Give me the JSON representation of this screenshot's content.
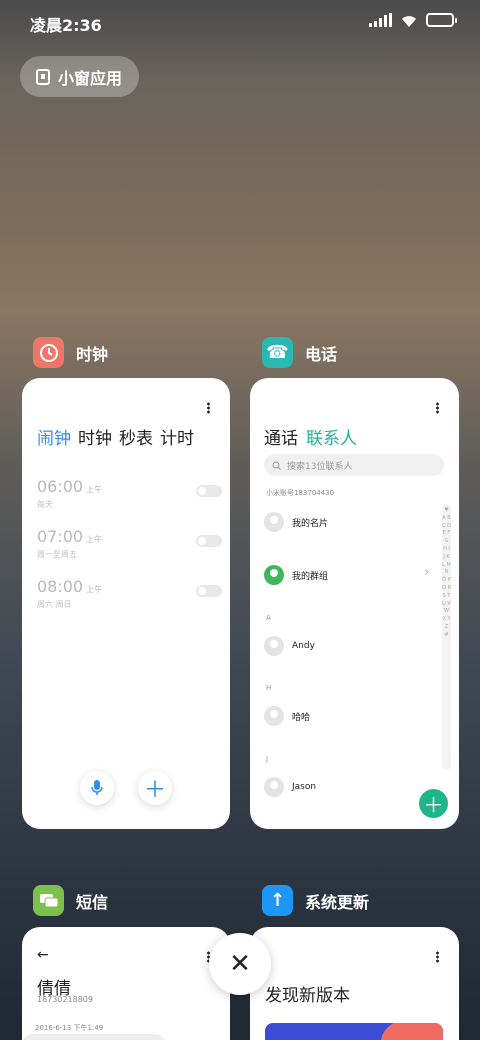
{
  "status": {
    "time": "凌晨2:36"
  },
  "float_window": {
    "label": "小窗应用"
  },
  "apps": {
    "clock": {
      "title": "时钟",
      "tabs": [
        "闹钟",
        "时钟",
        "秒表",
        "计时"
      ],
      "alarms": [
        {
          "time": "06:00",
          "ampm": "上午",
          "days": "每天"
        },
        {
          "time": "07:00",
          "ampm": "上午",
          "days": "周一至周五"
        },
        {
          "time": "08:00",
          "ampm": "上午",
          "days": "周六 周日"
        }
      ]
    },
    "phone": {
      "title": "电话",
      "tabs": [
        "通话",
        "联系人"
      ],
      "search_placeholder": "搜索13位联系人",
      "account": "小米账号183704430",
      "contacts": [
        "我的名片",
        "我的群组",
        "Andy",
        "哈哈",
        "Jason"
      ],
      "sections": [
        "A",
        "H",
        "J"
      ],
      "alphabet": "♥ A B C D E F G H I J K L M N O P Q R S T U V W X Y Z #"
    },
    "sms": {
      "title": "短信",
      "contact_name": "倩倩",
      "contact_number": "18730218809",
      "date": "2016-6-13 下午1:49"
    },
    "update": {
      "title": "系统更新",
      "headline": "发现新版本"
    }
  },
  "colors": {
    "clock_icon": "#f0766a",
    "phone_icon": "#29b8b3",
    "sms_icon": "#7cc14b",
    "update_icon": "#1e96f5"
  }
}
